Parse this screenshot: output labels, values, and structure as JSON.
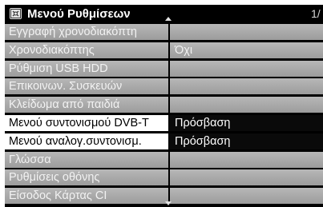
{
  "menu": {
    "title": "Μενού Ρυθμίσεων",
    "page": "1/",
    "items": [
      {
        "label": "Εγγραφή χρονοδιακόπτη",
        "value": "",
        "style": "normal"
      },
      {
        "label": "Χρονοδιακόπτης",
        "value": "Όχι",
        "style": "normal"
      },
      {
        "label": "Ρύθμιση USB HDD",
        "value": "",
        "style": "normal"
      },
      {
        "label": "Επικοινων. Συσκευών",
        "value": "",
        "style": "normal"
      },
      {
        "label": "Κλείδωμα από παιδιά",
        "value": "",
        "style": "normal"
      },
      {
        "label": "Μενού συντονισμού DVB-T",
        "value": "Πρόσβαση",
        "style": "highlight"
      },
      {
        "label": "Μενού αναλογ.συντονισμ.",
        "value": "Πρόσβαση",
        "style": "highlight"
      },
      {
        "label": "Γλώσσα",
        "value": "",
        "style": "normal"
      },
      {
        "label": "Ρυθμίσεις οθόνης",
        "value": "",
        "style": "normal"
      },
      {
        "label": "Είσοδος Κάρτας CI",
        "value": "",
        "style": "normal"
      }
    ]
  },
  "icons": {
    "title": "settings-menu-icon",
    "scroll_up": "triangle-up-icon",
    "scroll_down": "triangle-down-icon"
  },
  "colors": {
    "row_background": "#a9a9a9",
    "row_text": "#f2f2f2",
    "highlight_label_background": "#ffffff",
    "highlight_value_background": "#0a0a0a",
    "menu_background": "#000000"
  }
}
